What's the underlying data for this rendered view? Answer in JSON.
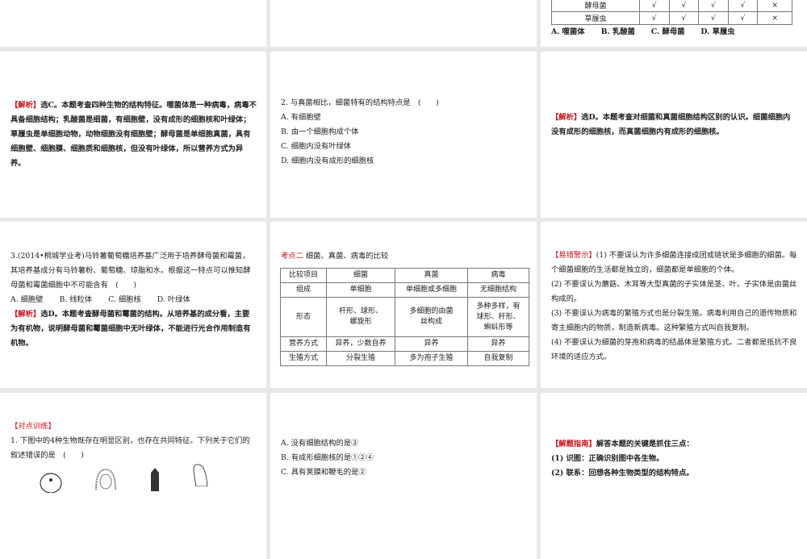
{
  "slide_top_right": {
    "table_rows": [
      {
        "name": "酵母菌",
        "marks": [
          "√",
          "√",
          "√",
          "√",
          "×"
        ]
      },
      {
        "name": "草履虫",
        "marks": [
          "√",
          "√",
          "√",
          "√",
          "×"
        ]
      }
    ],
    "options": [
      "A. 噬菌体",
      "B. 乳酸菌",
      "C. 酵母菌",
      "D. 草履虫"
    ]
  },
  "slide_analysis_1": {
    "tag": "【解析】",
    "text": "选C。本题考查四种生物的结构特征。噬菌体是一种病毒，病毒不具备细胞结构；乳酸菌是细菌，有细胞壁，没有成形的细胞核和叶绿体；草履虫是单细胞动物，动物细胞没有细胞壁；酵母菌是单细胞真菌，具有细胞壁、细胞膜、细胞质和细胞核，但没有叶绿体，所以营养方式为异养。"
  },
  "slide_question_2": {
    "question": "2. 与真菌相比，细菌特有的结构特点是　(　　)",
    "options": [
      "A. 有细胞壁",
      "B. 由一个细胞构成个体",
      "C. 细胞内没有叶绿体",
      "D. 细胞内没有成形的细胞核"
    ]
  },
  "slide_analysis_2": {
    "tag": "【解析】",
    "text": "选D。本题考查对细菌和真菌细胞结构区别的认识。细菌细胞内没有成形的细胞核，而真菌细胞内有成形的细胞核。"
  },
  "slide_question_3": {
    "question": "3.(2014•桐城学业考)马铃薯葡萄糖培养基广泛用于培养酵母菌和霉菌，其培养基成分有马铃薯粉、葡萄糖、琼脂和水。根据这一特点可以推知酵母菌和霉菌细胞中不可能含有　(　　)",
    "options": [
      "A. 细胞壁",
      "B. 线粒体",
      "C. 细胞核",
      "D. 叶绿体"
    ],
    "analysis_tag": "【解析】",
    "analysis": "选D。本题考查酵母菌和霉菌的结构。从培养基的成分看，主要为有机物，说明酵母菌和霉菌细胞中无叶绿体，不能进行光合作用制造有机物。"
  },
  "slide_comparison": {
    "heading_tag": "考点二",
    "heading": "细菌、真菌、病毒的比较",
    "header": [
      "比较项目",
      "细菌",
      "真菌",
      "病毒"
    ],
    "rows": [
      [
        "组成",
        "单细胞",
        "单细胞或多细胞",
        "无细胞结构"
      ],
      [
        "形态",
        "杆形、球形、螺旋形",
        "多细胞的由菌丝构成",
        "多种多样，有球形、杆形、蝌蚪形等"
      ],
      [
        "营养方式",
        "异养，少数自养",
        "异养",
        "异养"
      ],
      [
        "生殖方式",
        "分裂生殖",
        "多为孢子生殖",
        "自我复制"
      ]
    ]
  },
  "slide_warning": {
    "tag": "【易错警示】",
    "items": [
      "(1) 不要误认为许多细菌连接成团或链状是多细胞的细菌。每个细菌细胞的生活都是独立的，细菌都是单细胞的个体。",
      "(2) 不要误认为蘑菇、木耳等大型真菌的子实体是茎、叶。子实体是由菌丝构成的。",
      "(3) 不要误认为病毒的繁殖方式也是分裂生殖。病毒利用自己的遗传物质和寄主细胞内的物质，制造新病毒。这种繁殖方式叫自我复制。",
      "(4) 不要误认为细菌的芽孢和病毒的结晶体是繁殖方式。二者都是抵抗不良环境的适应方式。"
    ]
  },
  "slide_training": {
    "tag": "【对点训练】",
    "question": "1. 下图中的4种生物既存在明显区别，也存在共同特征。下列关于它们的叙述错误的是　(　　)"
  },
  "slide_training_options": {
    "options": [
      "A. 没有细胞结构的是③",
      "B. 有成形细胞核的是①②④",
      "C. 具有荚膜和鞭毛的是②"
    ]
  },
  "slide_guide": {
    "tag": "【解题指南】",
    "intro": "解答本题的关键是抓住三点：",
    "items": [
      "(1) 识图：正确识别图中各生物。",
      "(2) 联系：回想各种生物类型的结构特点。"
    ]
  }
}
